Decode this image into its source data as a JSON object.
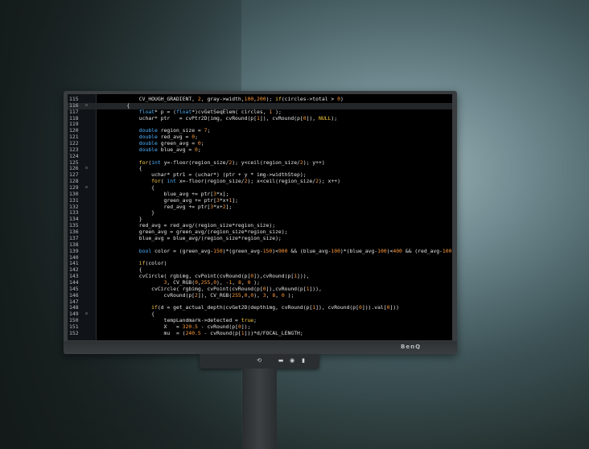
{
  "monitor": {
    "brand": "BenQ",
    "controls": [
      "touch-icon",
      "menu-icon",
      "settings-icon",
      "power-icon"
    ]
  },
  "editor": {
    "current_line": "116",
    "lines": [
      {
        "n": "115",
        "fold": "",
        "html": "        CV_HOUGH_GRADIENT, <span class=\"num\">2</span>, gray->width,<span class=\"num\">100</span>,<span class=\"num\">200</span>); <span class=\"ctl\">if</span>(circles->total > <span class=\"num\">0</span>)"
      },
      {
        "n": "116",
        "fold": "⊟",
        "html": "    {"
      },
      {
        "n": "117",
        "fold": "",
        "html": "        <span class=\"kw\">float</span>* p = (<span class=\"kw\">float</span>*)cvGetSeqElem( circles, <span class=\"num\">1</span> );"
      },
      {
        "n": "118",
        "fold": "",
        "html": "        uchar* ptr   = cvPtr2D(img, cvRound(p[<span class=\"num\">1</span>]), cvRound(p[<span class=\"num\">0</span>]), <span class=\"macro\">NULL</span>);"
      },
      {
        "n": "119",
        "fold": "",
        "html": ""
      },
      {
        "n": "120",
        "fold": "",
        "html": "        <span class=\"kw\">double</span> region_size = <span class=\"num\">7</span>;"
      },
      {
        "n": "121",
        "fold": "",
        "html": "        <span class=\"kw\">double</span> red_avg = <span class=\"num\">0</span>;"
      },
      {
        "n": "122",
        "fold": "",
        "html": "        <span class=\"kw\">double</span> green_avg = <span class=\"num\">0</span>;"
      },
      {
        "n": "123",
        "fold": "",
        "html": "        <span class=\"kw\">double</span> blue_avg = <span class=\"num\">0</span>;"
      },
      {
        "n": "124",
        "fold": "",
        "html": ""
      },
      {
        "n": "125",
        "fold": "",
        "html": "        <span class=\"ctl\">for</span>(<span class=\"kw\">int</span> y=-floor(region_size/<span class=\"num\">2</span>); y&lt;ceil(region_size/<span class=\"num\">2</span>); y++)"
      },
      {
        "n": "126",
        "fold": "⊟",
        "html": "        {"
      },
      {
        "n": "127",
        "fold": "",
        "html": "            uchar* ptr1 = (uchar*) (ptr + y * img->widthStep);"
      },
      {
        "n": "128",
        "fold": "",
        "html": "            <span class=\"ctl\">for</span>( <span class=\"kw\">int</span> x=-floor(region_size/<span class=\"num\">2</span>); x&lt;ceil(region_size/<span class=\"num\">2</span>); x++)"
      },
      {
        "n": "129",
        "fold": "⊟",
        "html": "            {"
      },
      {
        "n": "130",
        "fold": "",
        "html": "                blue_avg += ptr[<span class=\"num\">3</span>*x];"
      },
      {
        "n": "131",
        "fold": "",
        "html": "                green_avg += ptr[<span class=\"num\">3</span>*x+<span class=\"num\">1</span>];"
      },
      {
        "n": "132",
        "fold": "",
        "html": "                red_avg += ptr[<span class=\"num\">3</span>*x+<span class=\"num\">2</span>];"
      },
      {
        "n": "133",
        "fold": "",
        "html": "            }"
      },
      {
        "n": "134",
        "fold": "",
        "html": "        }"
      },
      {
        "n": "135",
        "fold": "",
        "html": "        red_avg = red_avg/(region_size*region_size);"
      },
      {
        "n": "136",
        "fold": "",
        "html": "        green_avg = green_avg/(region_size*region_size);"
      },
      {
        "n": "137",
        "fold": "",
        "html": "        blue_avg = blue_avg/(region_size*region_size);"
      },
      {
        "n": "138",
        "fold": "",
        "html": ""
      },
      {
        "n": "139",
        "fold": "",
        "html": "        <span class=\"kw\">bool</span> color = (green_avg-<span class=\"num\">150</span>)*(green_avg-<span class=\"num\">150</span>)&lt;<span class=\"num\">900</span> &amp;&amp; (blue_avg-<span class=\"num\">100</span>)*(blue_avg-<span class=\"num\">100</span>)&lt;<span class=\"num\">400</span> &amp;&amp; (red_avg-<span class=\"num\">100</span>"
      },
      {
        "n": "140",
        "fold": "",
        "html": ""
      },
      {
        "n": "141",
        "fold": "",
        "html": "        <span class=\"ctl\">if</span>(color)"
      },
      {
        "n": "142",
        "fold": "",
        "html": "        {"
      },
      {
        "n": "143",
        "fold": "",
        "html": "        cvCircle( rgbimg, cvPoint(cvRound(p[<span class=\"num\">0</span>]),cvRound(p[<span class=\"num\">1</span>])),"
      },
      {
        "n": "144",
        "fold": "",
        "html": "                <span class=\"num\">3</span>, CV_RGB(<span class=\"num\">0</span>,<span class=\"num\">255</span>,<span class=\"num\">0</span>), -<span class=\"num\">1</span>, <span class=\"num\">8</span>, <span class=\"num\">0</span> );"
      },
      {
        "n": "145",
        "fold": "",
        "html": "            cvCircle( rgbimg, cvPoint(cvRound(p[<span class=\"num\">0</span>]),cvRound(p[<span class=\"num\">1</span>])),"
      },
      {
        "n": "146",
        "fold": "",
        "html": "                cvRound(p[<span class=\"num\">2</span>]), CV_RGB(<span class=\"num\">255</span>,<span class=\"num\">0</span>,<span class=\"num\">0</span>), <span class=\"num\">3</span>, <span class=\"num\">8</span>, <span class=\"num\">0</span> );"
      },
      {
        "n": "147",
        "fold": "",
        "html": ""
      },
      {
        "n": "148",
        "fold": "",
        "html": "            <span class=\"ctl\">if</span>(d = get_actual_depth(cvGet2D(depthimg, cvRound(p[<span class=\"num\">1</span>]), cvRound(p[<span class=\"num\">0</span>])).val[<span class=\"num\">0</span>]))"
      },
      {
        "n": "149",
        "fold": "⊟",
        "html": "            {"
      },
      {
        "n": "150",
        "fold": "",
        "html": "                tempLandmark->detected = <span class=\"macro\">true</span>;"
      },
      {
        "n": "151",
        "fold": "",
        "html": "                X   = <span class=\"num\">320.5</span> - cvRound(p[<span class=\"num\">0</span>]);"
      },
      {
        "n": "152",
        "fold": "",
        "html": "                mu  = (<span class=\"num\">240.5</span> - cvRound(p[<span class=\"num\">1</span>]))*d/FOCAL_LENGTH;"
      }
    ]
  }
}
